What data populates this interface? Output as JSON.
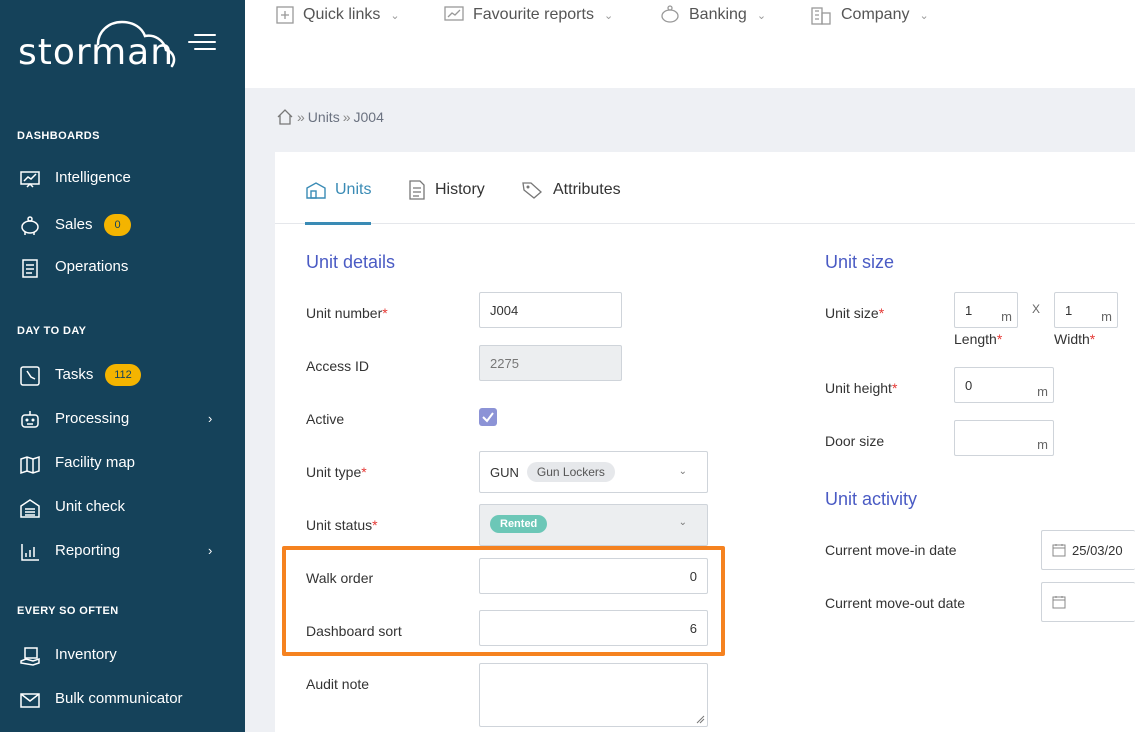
{
  "app": {
    "logo_text": "storman"
  },
  "sidebar": {
    "sections": [
      {
        "title": "DASHBOARDS"
      },
      {
        "title": "DAY TO DAY"
      },
      {
        "title": "EVERY SO OFTEN"
      }
    ],
    "items": [
      {
        "label": "Intelligence",
        "icon": "chart-board-icon"
      },
      {
        "label": "Sales",
        "icon": "piggy-bank-icon",
        "badge": "0"
      },
      {
        "label": "Operations",
        "icon": "clipboard-icon"
      },
      {
        "label": "Tasks",
        "icon": "clock-icon",
        "badge": "112"
      },
      {
        "label": "Processing",
        "icon": "robot-icon",
        "chevron": "›"
      },
      {
        "label": "Facility map",
        "icon": "map-icon"
      },
      {
        "label": "Unit check",
        "icon": "garage-icon"
      },
      {
        "label": "Reporting",
        "icon": "bar-chart-icon",
        "chevron": "›"
      },
      {
        "label": "Inventory",
        "icon": "box-hand-icon"
      },
      {
        "label": "Bulk communicator",
        "icon": "envelope-icon"
      }
    ]
  },
  "topbar": {
    "items": [
      {
        "label": "Quick links",
        "icon": "plus-square-icon"
      },
      {
        "label": "Favourite reports",
        "icon": "chart-icon"
      },
      {
        "label": "Banking",
        "icon": "piggy-bank-icon"
      },
      {
        "label": "Company",
        "icon": "building-icon"
      }
    ]
  },
  "breadcrumb": {
    "items": [
      "Units",
      "J004"
    ],
    "separator": "»"
  },
  "tabs": [
    {
      "label": "Units",
      "active": true
    },
    {
      "label": "History",
      "active": false
    },
    {
      "label": "Attributes",
      "active": false
    }
  ],
  "unit_details": {
    "title": "Unit details",
    "unit_number_label": "Unit number",
    "unit_number_value": "J004",
    "access_id_label": "Access ID",
    "access_id_value": "2275",
    "active_label": "Active",
    "active_checked": true,
    "unit_type_label": "Unit type",
    "unit_type_code": "GUN",
    "unit_type_tag": "Gun Lockers",
    "unit_status_label": "Unit status",
    "unit_status_value": "Rented",
    "walk_order_label": "Walk order",
    "walk_order_value": "0",
    "dashboard_sort_label": "Dashboard sort",
    "dashboard_sort_value": "6",
    "audit_note_label": "Audit note",
    "required_mark": "*"
  },
  "unit_size": {
    "title": "Unit size",
    "unit_size_label": "Unit size",
    "length_value": "1",
    "width_value": "1",
    "unit_suffix": "m",
    "times": "X",
    "length_label": "Length",
    "width_label": "Width",
    "height_label": "Unit height",
    "height_value": "0",
    "door_size_label": "Door size",
    "door_size_value": ""
  },
  "unit_activity": {
    "title": "Unit activity",
    "move_in_label": "Current move-in date",
    "move_in_value": "25/03/20",
    "move_out_label": "Current move-out date",
    "move_out_value": ""
  },
  "colors": {
    "sidebar_bg": "#15425a",
    "accent": "#3a8bb5",
    "section_title": "#4a5bc4",
    "badge": "#f4b400",
    "highlight": "#f58220",
    "rented": "#6cc7b7"
  }
}
